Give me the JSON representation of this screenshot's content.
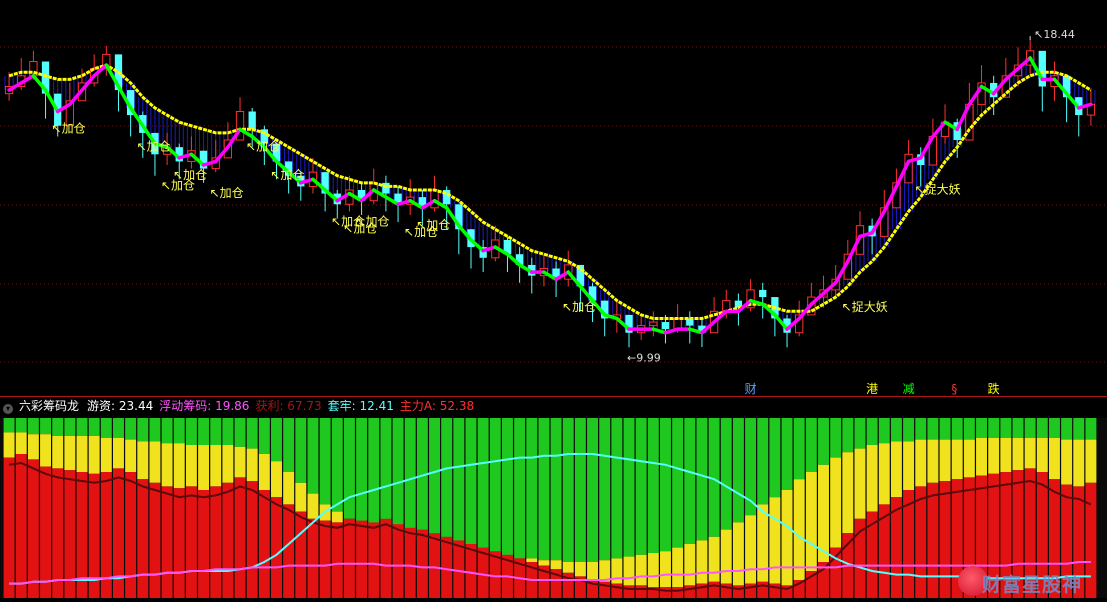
{
  "indicator": {
    "name": "六彩筹码龙",
    "values": [
      {
        "label": "游资:",
        "value": "23.44",
        "color": "#ffffff"
      },
      {
        "label": "浮动筹码:",
        "value": "19.86",
        "color": "#ff55ff"
      },
      {
        "label": "获利:",
        "value": "67.73",
        "color": "#a01818"
      },
      {
        "label": "套牢:",
        "value": "12.41",
        "color": "#55ffff"
      },
      {
        "label": "主力A:",
        "value": "52.38",
        "color": "#ff3030"
      }
    ]
  },
  "price_labels": {
    "high": "18.44",
    "low": "9.99"
  },
  "signals": [
    "加仓",
    "加仓",
    "加仓",
    "加仓",
    "加仓",
    "加仓",
    "加仓",
    "加仓",
    "加仓",
    "加仓",
    "加仓",
    "加仓",
    "加仓",
    "捉大妖",
    "捉大妖"
  ],
  "event_markers": [
    {
      "text": "财",
      "color": "#5aa0ff"
    },
    {
      "text": "港",
      "color": "#ffff00"
    },
    {
      "text": "减",
      "color": "#00ff00"
    },
    {
      "text": "§",
      "color": "#ff3030"
    },
    {
      "text": "跌",
      "color": "#ffff00"
    }
  ],
  "watermark": {
    "text": "财富星股神"
  },
  "colors": {
    "up": "#ff3030",
    "down": "#54ffff",
    "upper_line": "#ffff00",
    "lower_up": "#ff00ff",
    "lower_down": "#00ff00",
    "fill": "#1c1cc8"
  },
  "chart_data": [
    {
      "type": "candlestick",
      "title": "",
      "xlabel": "",
      "ylabel": "",
      "ylim": [
        9.3,
        19.5
      ],
      "close": [
        17.3,
        17.6,
        18.0,
        17.1,
        16.2,
        16.9,
        17.4,
        17.8,
        18.2,
        17.2,
        16.5,
        16.0,
        15.4,
        15.6,
        15.2,
        15.5,
        15.0,
        15.3,
        15.8,
        16.6,
        16.1,
        15.7,
        15.2,
        14.8,
        14.5,
        14.9,
        14.3,
        14.0,
        14.4,
        14.1,
        14.6,
        14.3,
        14.0,
        14.2,
        13.9,
        14.4,
        14.0,
        13.3,
        12.8,
        12.5,
        13.0,
        12.6,
        12.3,
        12.0,
        12.2,
        11.9,
        12.3,
        11.7,
        11.3,
        10.8,
        10.9,
        10.4,
        10.6,
        10.7,
        10.5,
        10.8,
        10.6,
        10.4,
        11.0,
        11.3,
        11.1,
        11.6,
        11.4,
        10.8,
        10.4,
        10.9,
        11.4,
        11.6,
        11.9,
        12.6,
        13.4,
        13.1,
        13.9,
        14.6,
        15.4,
        15.1,
        15.9,
        16.3,
        15.8,
        16.8,
        17.4,
        17.0,
        17.6,
        17.9,
        18.3,
        17.3,
        17.6,
        17.0,
        16.5,
        16.8
      ],
      "high": [
        17.7,
        18.1,
        18.3,
        17.6,
        17.0,
        17.4,
        17.8,
        18.2,
        18.44,
        17.8,
        17.0,
        16.6,
        15.9,
        16.0,
        15.7,
        15.9,
        15.5,
        15.8,
        16.3,
        17.0,
        16.7,
        16.2,
        15.7,
        15.2,
        14.9,
        15.3,
        14.9,
        14.4,
        14.8,
        14.6,
        15.0,
        14.8,
        14.5,
        14.7,
        14.4,
        14.8,
        14.5,
        13.9,
        13.3,
        13.0,
        13.4,
        13.1,
        12.8,
        12.5,
        12.6,
        12.4,
        12.7,
        12.3,
        11.8,
        11.3,
        11.3,
        10.9,
        10.9,
        11.0,
        10.9,
        11.2,
        11.0,
        10.8,
        11.4,
        11.6,
        11.5,
        11.9,
        11.8,
        11.3,
        10.9,
        11.3,
        11.8,
        12.0,
        12.3,
        13.0,
        13.8,
        13.6,
        14.4,
        15.0,
        15.8,
        15.6,
        16.4,
        16.8,
        16.4,
        17.4,
        17.9,
        17.6,
        18.1,
        18.4,
        18.6,
        18.1,
        18.0,
        17.6,
        17.0,
        17.2
      ],
      "low": [
        16.9,
        17.2,
        17.5,
        16.4,
        15.9,
        16.3,
        16.9,
        17.3,
        17.6,
        16.6,
        15.9,
        15.3,
        14.8,
        15.1,
        14.7,
        15.0,
        14.6,
        14.9,
        15.3,
        15.9,
        15.6,
        15.1,
        14.7,
        14.3,
        14.1,
        14.3,
        13.8,
        13.6,
        13.8,
        13.7,
        14.0,
        13.8,
        13.5,
        13.7,
        13.4,
        13.8,
        13.3,
        12.6,
        12.2,
        12.1,
        12.4,
        12.1,
        11.8,
        11.5,
        11.7,
        11.4,
        11.7,
        11.0,
        10.7,
        10.3,
        10.4,
        9.99,
        10.2,
        10.3,
        10.1,
        10.4,
        10.1,
        10.0,
        10.5,
        10.8,
        10.6,
        11.0,
        10.8,
        10.3,
        9.99,
        10.3,
        10.9,
        11.1,
        11.4,
        12.0,
        12.8,
        12.6,
        13.3,
        14.0,
        14.7,
        14.5,
        15.2,
        15.7,
        15.3,
        16.2,
        16.8,
        16.5,
        17.0,
        17.3,
        17.6,
        16.6,
        16.9,
        16.3,
        15.9,
        16.2
      ],
      "upper_line": [
        17.6,
        17.7,
        17.7,
        17.6,
        17.5,
        17.5,
        17.6,
        17.8,
        17.9,
        17.7,
        17.4,
        17.0,
        16.7,
        16.5,
        16.3,
        16.2,
        16.1,
        16.0,
        16.0,
        16.1,
        16.1,
        16.0,
        15.8,
        15.6,
        15.4,
        15.2,
        15.0,
        14.8,
        14.7,
        14.6,
        14.6,
        14.5,
        14.5,
        14.4,
        14.4,
        14.4,
        14.3,
        14.1,
        13.8,
        13.5,
        13.3,
        13.1,
        12.9,
        12.7,
        12.6,
        12.5,
        12.4,
        12.2,
        11.9,
        11.6,
        11.3,
        11.1,
        10.9,
        10.8,
        10.8,
        10.8,
        10.8,
        10.8,
        10.9,
        11.0,
        11.1,
        11.2,
        11.2,
        11.1,
        11.0,
        11.0,
        11.0,
        11.2,
        11.4,
        11.7,
        12.1,
        12.4,
        12.8,
        13.3,
        13.8,
        14.2,
        14.7,
        15.2,
        15.6,
        16.1,
        16.5,
        16.8,
        17.1,
        17.4,
        17.6,
        17.7,
        17.7,
        17.6,
        17.4,
        17.2
      ],
      "lower_line": [
        17.2,
        17.4,
        17.6,
        17.2,
        16.6,
        16.8,
        17.2,
        17.6,
        17.9,
        17.3,
        16.7,
        16.2,
        15.7,
        15.6,
        15.3,
        15.4,
        15.1,
        15.2,
        15.6,
        16.1,
        15.9,
        15.6,
        15.2,
        14.9,
        14.6,
        14.7,
        14.4,
        14.1,
        14.3,
        14.1,
        14.4,
        14.2,
        14.0,
        14.1,
        13.9,
        14.1,
        13.9,
        13.4,
        13.0,
        12.7,
        12.8,
        12.6,
        12.3,
        12.1,
        12.1,
        11.9,
        12.1,
        11.7,
        11.3,
        10.9,
        10.8,
        10.5,
        10.5,
        10.5,
        10.4,
        10.5,
        10.5,
        10.4,
        10.7,
        11.0,
        11.0,
        11.3,
        11.2,
        10.9,
        10.5,
        10.8,
        11.2,
        11.5,
        11.8,
        12.4,
        13.1,
        13.2,
        13.8,
        14.5,
        15.2,
        15.3,
        15.9,
        16.3,
        16.1,
        16.8,
        17.3,
        17.1,
        17.5,
        17.8,
        18.1,
        17.5,
        17.5,
        17.1,
        16.7,
        16.8
      ],
      "signal_index": [
        3,
        10,
        12,
        13,
        16,
        19,
        21,
        26,
        27,
        28,
        32,
        33,
        45,
        68,
        74
      ],
      "marker_index": [
        61,
        71,
        74,
        78,
        81
      ]
    },
    {
      "type": "bar",
      "title": "",
      "xlabel": "",
      "ylabel": "",
      "ylim": [
        0,
        100
      ],
      "series": [
        {
          "name": "获利",
          "values": [
            78,
            80,
            77,
            73,
            72,
            71,
            70,
            69,
            70,
            72,
            70,
            66,
            64,
            62,
            61,
            62,
            60,
            62,
            64,
            67,
            65,
            60,
            56,
            52,
            48,
            44,
            43,
            42,
            44,
            43,
            42,
            44,
            41,
            39,
            38,
            36,
            34,
            32,
            30,
            28,
            26,
            24,
            22,
            20,
            18,
            16,
            14,
            12,
            10,
            9,
            8,
            7,
            7,
            6,
            6,
            6,
            7,
            8,
            9,
            8,
            7,
            8,
            9,
            8,
            7,
            10,
            15,
            20,
            28,
            36,
            44,
            48,
            52,
            56,
            60,
            62,
            64,
            65,
            66,
            67,
            68,
            69,
            70,
            71,
            72,
            70,
            66,
            63,
            62,
            64
          ]
        },
        {
          "name": "套牢",
          "values": [
            8,
            8,
            9,
            9,
            10,
            10,
            10,
            10,
            11,
            11,
            12,
            13,
            13,
            14,
            14,
            15,
            15,
            15,
            15,
            16,
            17,
            20,
            24,
            30,
            36,
            42,
            48,
            52,
            56,
            58,
            60,
            62,
            64,
            66,
            68,
            70,
            72,
            73,
            74,
            75,
            76,
            77,
            78,
            78,
            79,
            79,
            80,
            80,
            80,
            79,
            78,
            77,
            76,
            75,
            74,
            72,
            70,
            68,
            66,
            62,
            58,
            54,
            48,
            44,
            40,
            34,
            30,
            26,
            22,
            19,
            17,
            15,
            14,
            13,
            13,
            12,
            12,
            12,
            12,
            12,
            11,
            11,
            11,
            11,
            11,
            11,
            11,
            12,
            12,
            12
          ]
        },
        {
          "name": "浮动筹码",
          "values": [
            8,
            8,
            9,
            9,
            10,
            10,
            11,
            11,
            11,
            12,
            12,
            13,
            13,
            14,
            14,
            15,
            15,
            16,
            16,
            16,
            17,
            17,
            17,
            18,
            18,
            18,
            18,
            19,
            19,
            19,
            19,
            18,
            18,
            18,
            17,
            17,
            16,
            15,
            14,
            13,
            12,
            12,
            11,
            10,
            10,
            10,
            10,
            10,
            10,
            10,
            11,
            11,
            12,
            12,
            13,
            13,
            13,
            14,
            14,
            15,
            15,
            16,
            16,
            17,
            17,
            17,
            17,
            17,
            17,
            18,
            18,
            18,
            18,
            18,
            18,
            18,
            18,
            18,
            18,
            18,
            18,
            18,
            18,
            19,
            19,
            19,
            19,
            19,
            20,
            20
          ]
        },
        {
          "name": "主力A",
          "values": [
            74,
            75,
            72,
            69,
            67,
            66,
            65,
            64,
            65,
            67,
            65,
            62,
            60,
            58,
            56,
            57,
            56,
            57,
            59,
            62,
            60,
            56,
            52,
            49,
            45,
            42,
            40,
            39,
            41,
            40,
            39,
            41,
            38,
            36,
            35,
            33,
            31,
            29,
            27,
            25,
            23,
            21,
            19,
            17,
            15,
            13,
            11,
            10,
            8,
            7,
            6,
            5,
            5,
            5,
            4,
            4,
            5,
            6,
            7,
            6,
            5,
            6,
            7,
            6,
            5,
            8,
            12,
            16,
            23,
            30,
            37,
            41,
            45,
            49,
            52,
            55,
            57,
            58,
            59,
            60,
            61,
            62,
            63,
            64,
            65,
            63,
            59,
            56,
            55,
            52
          ]
        }
      ]
    }
  ]
}
